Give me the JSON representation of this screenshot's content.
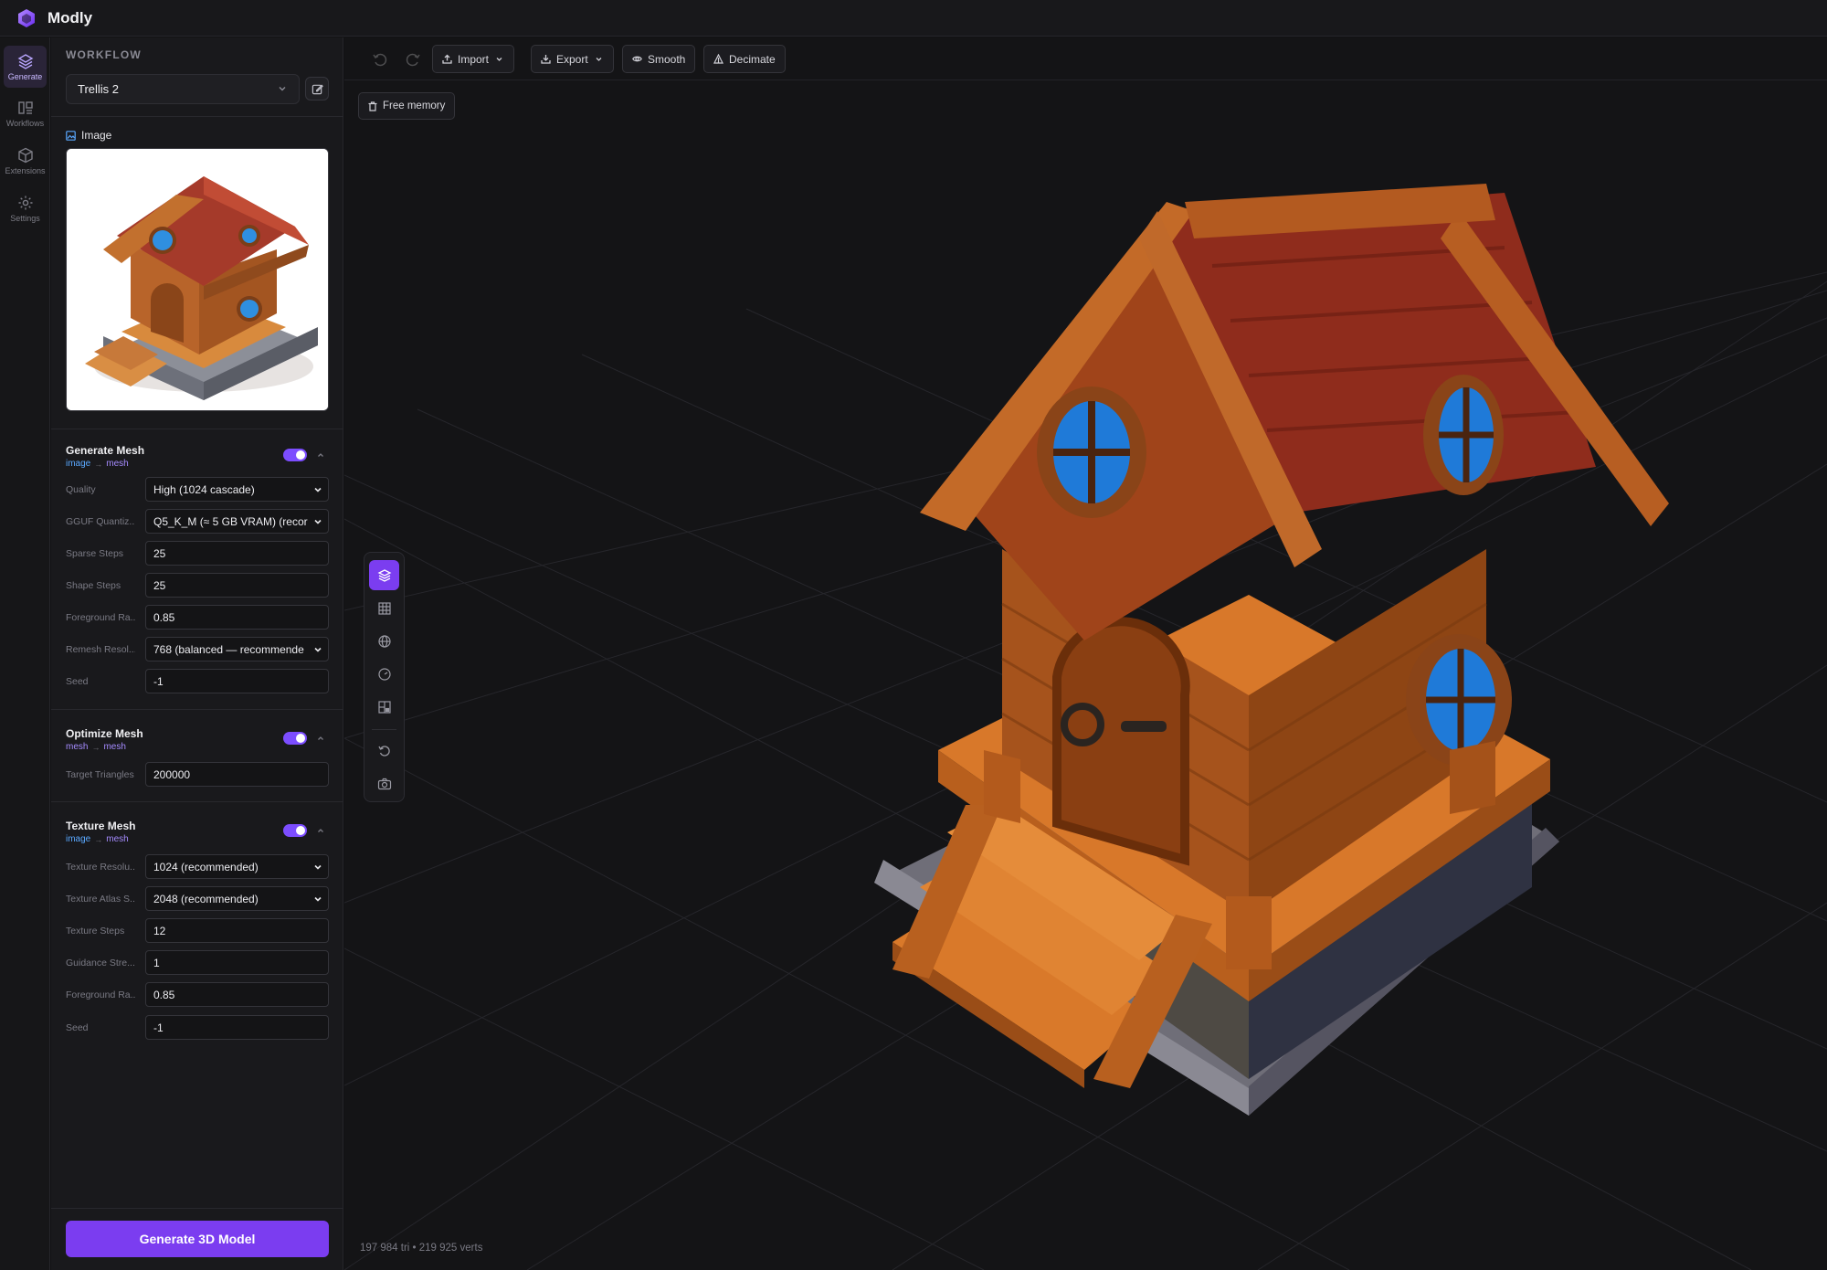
{
  "app": {
    "title": "Modly"
  },
  "rail": [
    {
      "label": "Generate",
      "icon": "layers-icon",
      "active": true
    },
    {
      "label": "Workflows",
      "icon": "columns-icon",
      "active": false
    },
    {
      "label": "Extensions",
      "icon": "cube-icon",
      "active": false
    },
    {
      "label": "Settings",
      "icon": "gear-icon",
      "active": false
    }
  ],
  "panel": {
    "heading": "WORKFLOW",
    "workflow": "Trellis 2",
    "image_label": "Image"
  },
  "nodes": {
    "generate": {
      "title": "Generate Mesh",
      "in": "image",
      "out": "mesh",
      "enabled": true,
      "fields": [
        {
          "label": "Quality",
          "value": "High (1024 cascade)",
          "type": "select"
        },
        {
          "label": "GGUF Quantiz...",
          "value": "Q5_K_M (≈ 5 GB VRAM) (recor",
          "type": "select"
        },
        {
          "label": "Sparse Steps",
          "value": "25",
          "type": "input"
        },
        {
          "label": "Shape Steps",
          "value": "25",
          "type": "input"
        },
        {
          "label": "Foreground Ra...",
          "value": "0.85",
          "type": "input"
        },
        {
          "label": "Remesh Resol...",
          "value": "768 (balanced — recommende",
          "type": "select"
        },
        {
          "label": "Seed",
          "value": "-1",
          "type": "input"
        }
      ]
    },
    "optimize": {
      "title": "Optimize Mesh",
      "in": "mesh",
      "out": "mesh",
      "enabled": true,
      "fields": [
        {
          "label": "Target Triangles",
          "value": "200000",
          "type": "input"
        }
      ]
    },
    "texture": {
      "title": "Texture Mesh",
      "in": "image",
      "out": "mesh",
      "enabled": true,
      "fields": [
        {
          "label": "Texture Resolu...",
          "value": "1024 (recommended)",
          "type": "select"
        },
        {
          "label": "Texture Atlas S...",
          "value": "2048 (recommended)",
          "type": "select"
        },
        {
          "label": "Texture Steps",
          "value": "12",
          "type": "input"
        },
        {
          "label": "Guidance Stre...",
          "value": "1",
          "type": "input"
        },
        {
          "label": "Foreground Ra...",
          "value": "0.85",
          "type": "input"
        },
        {
          "label": "Seed",
          "value": "-1",
          "type": "input"
        }
      ]
    }
  },
  "generate_button": "Generate 3D Model",
  "toolbar": {
    "import": "Import",
    "export": "Export",
    "smooth": "Smooth",
    "decimate": "Decimate"
  },
  "viewport": {
    "free_memory": "Free memory",
    "stats": "197 984 tri • 219 925 verts"
  },
  "colors": {
    "accent": "#7b3df0",
    "io_image": "#5aa8ff",
    "io_mesh": "#a58bff"
  }
}
